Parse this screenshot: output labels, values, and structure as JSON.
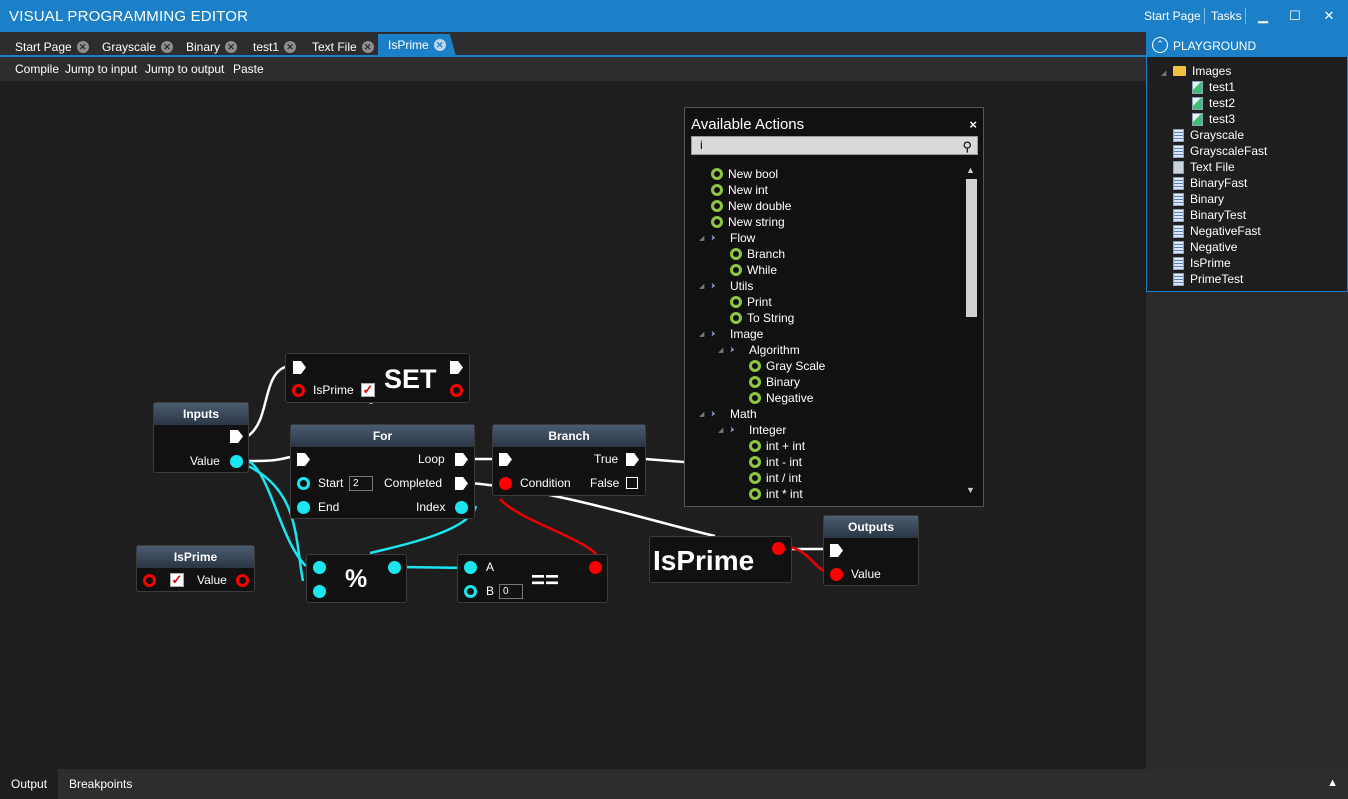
{
  "app": {
    "title": "VISUAL PROGRAMMING EDITOR",
    "start_page": "Start Page",
    "tasks": "Tasks",
    "minimize": "▁",
    "maximize": "☐",
    "close": "✕"
  },
  "tabs": [
    {
      "label": "Start Page",
      "close": "✕"
    },
    {
      "label": "Grayscale",
      "close": "✕"
    },
    {
      "label": "Binary",
      "close": "✕"
    },
    {
      "label": "test1",
      "close": "✕"
    },
    {
      "label": "Text File",
      "close": "✕"
    },
    {
      "label": "IsPrime",
      "close": "✕",
      "active": true
    }
  ],
  "toolbar": {
    "compile": "Compile",
    "jump_input": "Jump to input",
    "jump_output": "Jump to output",
    "paste": "Paste"
  },
  "nodes": {
    "set": {
      "exec_label": "",
      "pin_label": "IsPrime",
      "checked": "✓",
      "title": "SET"
    },
    "inputs": {
      "title": "Inputs",
      "value": "Value"
    },
    "for": {
      "title": "For",
      "loop": "Loop",
      "start": "Start",
      "start_value": "2",
      "completed": "Completed",
      "end": "End",
      "index": "Index"
    },
    "branch": {
      "title": "Branch",
      "true": "True",
      "condition": "Condition",
      "false": "False"
    },
    "isprime_var": {
      "title": "IsPrime",
      "checked": "✓",
      "value": "Value"
    },
    "modulo": {
      "title": "%"
    },
    "equals": {
      "title": "==",
      "a": "A",
      "b": "B",
      "b_value": "0"
    },
    "isprime_get": {
      "title": "IsPrime"
    },
    "outputs": {
      "title": "Outputs",
      "value": "Value"
    }
  },
  "actions": {
    "title": "Available Actions",
    "close": "×",
    "search_value": "i",
    "items": [
      {
        "label": "New bool",
        "kind": "action"
      },
      {
        "label": "New int",
        "kind": "action"
      },
      {
        "label": "New double",
        "kind": "action"
      },
      {
        "label": "New string",
        "kind": "action"
      },
      {
        "label": "Flow",
        "kind": "category"
      },
      {
        "label": "Branch",
        "kind": "action"
      },
      {
        "label": "While",
        "kind": "action"
      },
      {
        "label": "Utils",
        "kind": "category"
      },
      {
        "label": "Print",
        "kind": "action"
      },
      {
        "label": "To String",
        "kind": "action"
      },
      {
        "label": "Image",
        "kind": "category"
      },
      {
        "label": "Algorithm",
        "kind": "category"
      },
      {
        "label": "Gray Scale",
        "kind": "action"
      },
      {
        "label": "Binary",
        "kind": "action"
      },
      {
        "label": "Negative",
        "kind": "action"
      },
      {
        "label": "Math",
        "kind": "category"
      },
      {
        "label": "Integer",
        "kind": "category"
      },
      {
        "label": "int + int",
        "kind": "action"
      },
      {
        "label": "int - int",
        "kind": "action"
      },
      {
        "label": "int / int",
        "kind": "action"
      },
      {
        "label": "int * int",
        "kind": "action"
      }
    ]
  },
  "playground": {
    "title": "PLAYGROUND",
    "items": [
      {
        "label": "Images",
        "type": "folder"
      },
      {
        "label": "test1",
        "type": "image"
      },
      {
        "label": "test2",
        "type": "image"
      },
      {
        "label": "test3",
        "type": "image"
      },
      {
        "label": "Grayscale",
        "type": "graph"
      },
      {
        "label": "GrayscaleFast",
        "type": "graph"
      },
      {
        "label": "Text File",
        "type": "text"
      },
      {
        "label": "BinaryFast",
        "type": "graph"
      },
      {
        "label": "Binary",
        "type": "graph"
      },
      {
        "label": "BinaryTest",
        "type": "graph"
      },
      {
        "label": "NegativeFast",
        "type": "graph"
      },
      {
        "label": "Negative",
        "type": "graph"
      },
      {
        "label": "IsPrime",
        "type": "graph"
      },
      {
        "label": "PrimeTest",
        "type": "graph"
      }
    ]
  },
  "bottom": {
    "output": "Output",
    "breakpoints": "Breakpoints",
    "expand": "▲"
  },
  "colors": {
    "accent": "#1c80c8",
    "int_pin": "#1be6f0",
    "bool_pin": "#ff0000",
    "action_ring": "#8fc63f"
  }
}
